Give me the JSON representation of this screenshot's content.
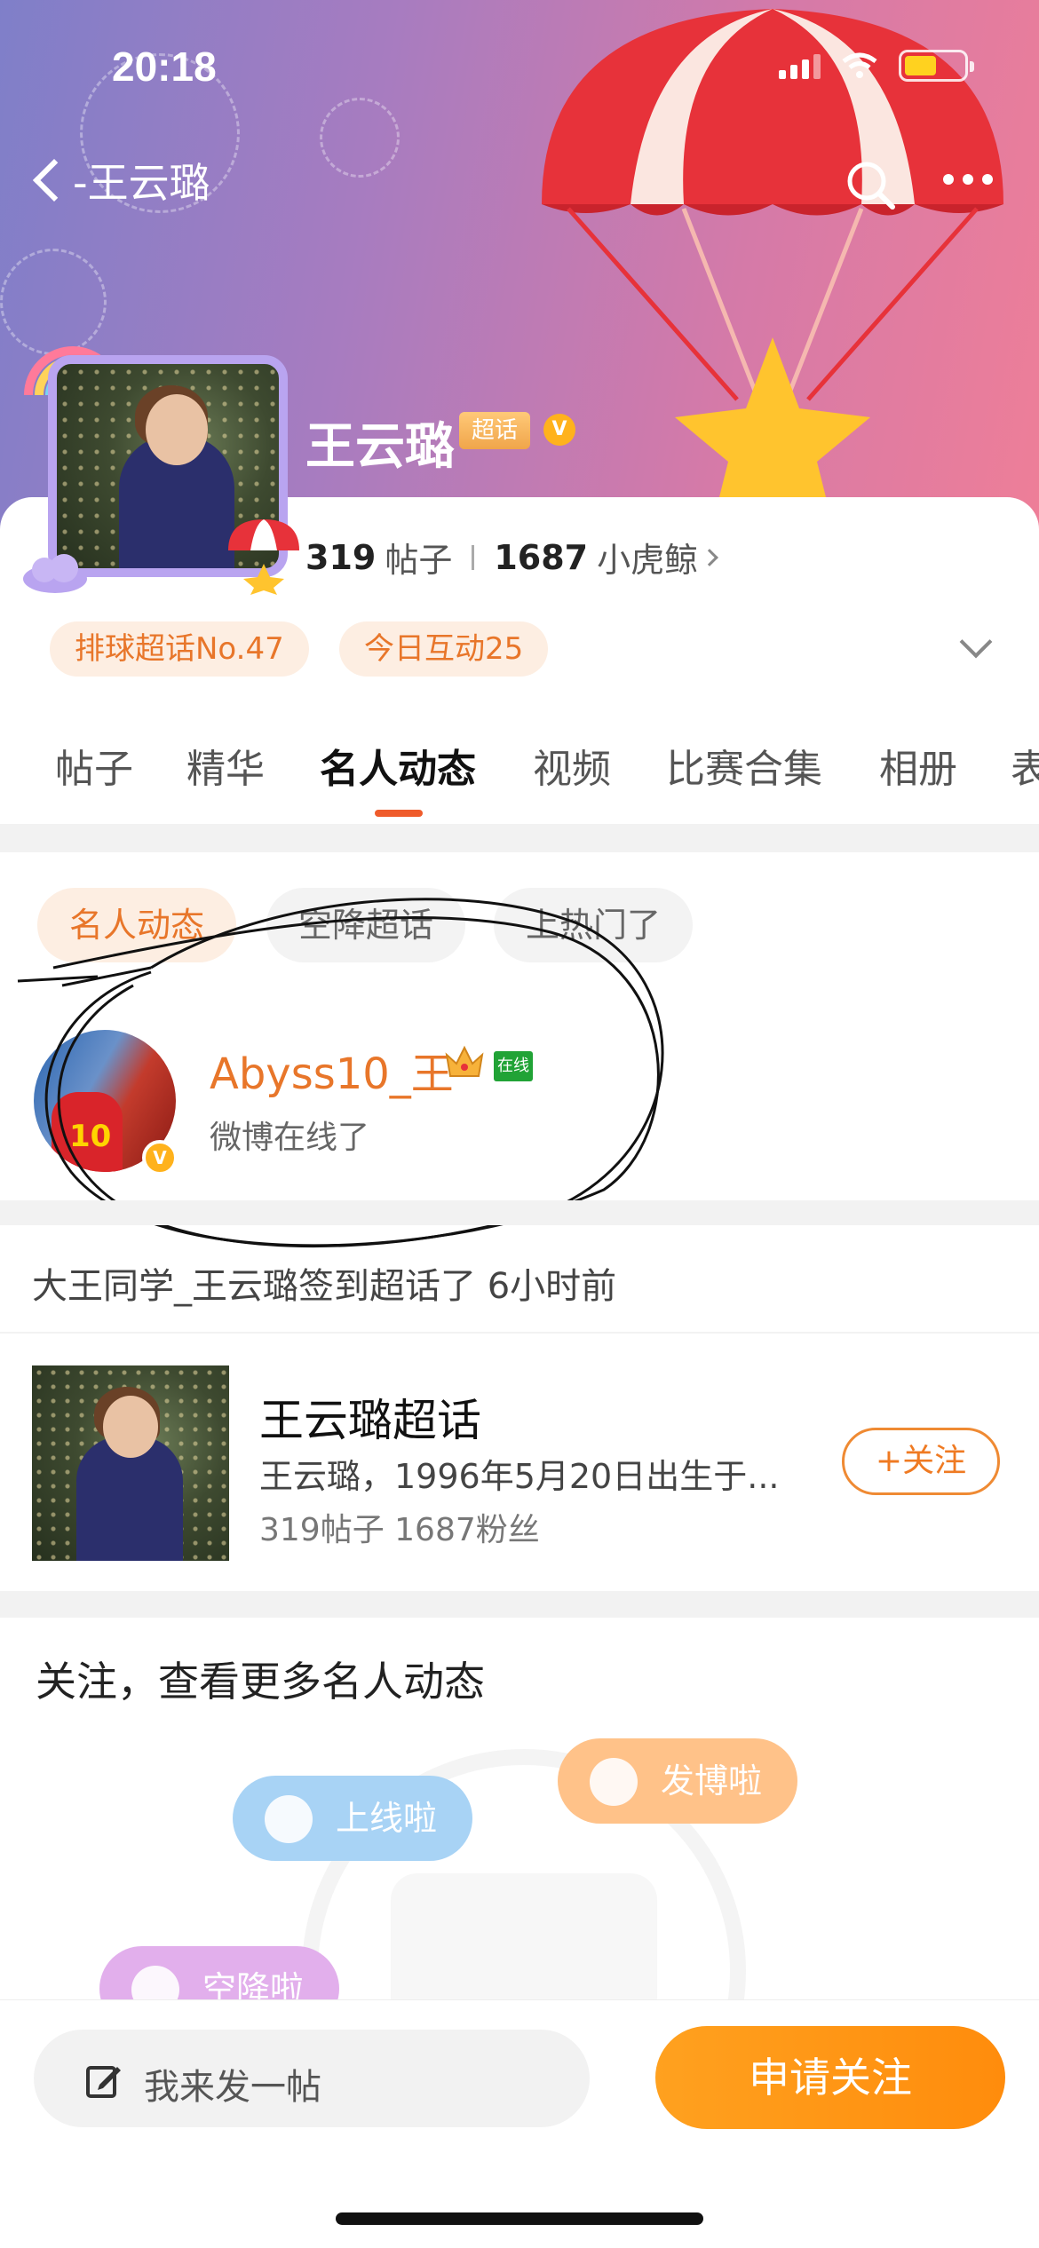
{
  "status_bar": {
    "time": "20:18"
  },
  "header": {
    "back_label": "-王云璐",
    "search_icon": "search-icon",
    "more_icon": "more-icon"
  },
  "profile": {
    "name": "王云璐",
    "super_tag": "超话",
    "verified_mark": "V",
    "posts_count": "319",
    "posts_label": "帖子",
    "fans_count": "1687",
    "fans_label": "小虎鲸",
    "rank_pill": "排球超话No.47",
    "interact_pill": "今日互动25"
  },
  "tabs": [
    "帖子",
    "精华",
    "名人动态",
    "视频",
    "比赛合集",
    "相册",
    "表"
  ],
  "active_tab": "名人动态",
  "filter_chips": [
    "名人动态",
    "空降超话",
    "上热门了"
  ],
  "celebrity": {
    "name": "Abyss10_王",
    "online_tag": "在线",
    "status": "微博在线了",
    "jersey_number": "10",
    "verified_mark": "V"
  },
  "checkin_text": "大王同学_王云璐签到超话了 6小时前",
  "topic_card": {
    "title": "王云璐超话",
    "description": "王云璐，1996年5月20日出生于...",
    "stats": "319帖子  1687粉丝",
    "follow_label": "+关注"
  },
  "more_section": {
    "title": "关注，查看更多名人动态",
    "pills": [
      "上线啦",
      "发博啦",
      "空降啦"
    ]
  },
  "bottom_bar": {
    "post_placeholder": "我来发一帖",
    "apply_label": "申请关注"
  },
  "colors": {
    "accent_orange": "#e8762a",
    "tab_underline": "#ef5b2b",
    "apply_button": "#ff9a17",
    "online_green": "#21a336"
  }
}
